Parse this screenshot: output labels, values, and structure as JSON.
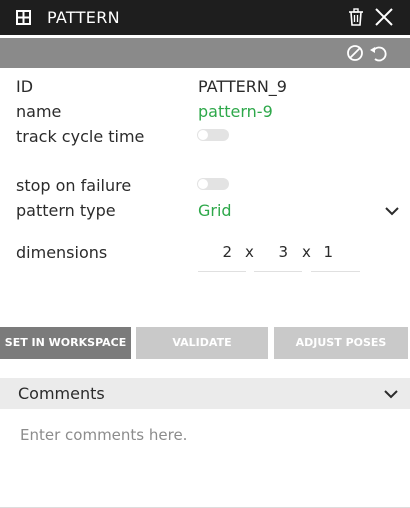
{
  "header": {
    "title": "PATTERN",
    "colors": {
      "background": "#1e1e1e",
      "text": "#ffffff"
    },
    "icons": {
      "leading": "grid-icon",
      "delete": "trash-icon",
      "close": "close-icon"
    }
  },
  "toolbar": {
    "icons": [
      "ban-icon",
      "undo-icon"
    ],
    "color": "#8a8a8a"
  },
  "fields": {
    "id": {
      "label": "ID",
      "value": "PATTERN_9"
    },
    "name": {
      "label": "name",
      "value": "pattern-9"
    },
    "track_cycle_time": {
      "label": "track cycle time",
      "on": false
    },
    "stop_on_failure": {
      "label": "stop on failure",
      "on": false
    },
    "pattern_type": {
      "label": "pattern type",
      "value": "Grid"
    },
    "dimensions": {
      "label": "dimensions",
      "x": "2",
      "y": "3",
      "z": "1",
      "separator": "x"
    }
  },
  "accent_green": "#2ea84a",
  "buttons": {
    "set_in_workspace": "SET IN WORKSPACE",
    "validate": "VALIDATE",
    "adjust_poses": "ADJUST POSES"
  },
  "comments": {
    "title": "Comments",
    "placeholder": "Enter comments here."
  }
}
